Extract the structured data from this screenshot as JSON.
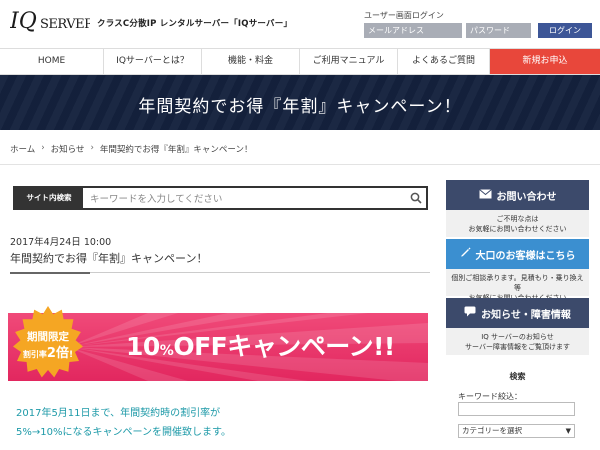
{
  "header": {
    "logo_text": "IQSERVER",
    "tagline": "クラスC分散IP レンタルサーバー「IQサーバー」",
    "login": {
      "label": "ユーザー画面ログイン",
      "email_placeholder": "メールアドレス",
      "password_placeholder": "パスワード",
      "button": "ログイン"
    }
  },
  "nav": {
    "items": [
      {
        "label": "HOME"
      },
      {
        "label": "IQサーバーとは？"
      },
      {
        "label": "機能・料金"
      },
      {
        "label": "ご利用マニュアル"
      },
      {
        "label": "よくあるご質問"
      },
      {
        "label": "新規お申込"
      }
    ]
  },
  "banner": {
    "title": "年間契約でお得『年割』キャンペーン！"
  },
  "breadcrumb": [
    "ホーム",
    "お知らせ",
    "年間契約でお得『年割』キャンペーン！"
  ],
  "search": {
    "label": "サイト内検索",
    "placeholder": "キーワードを入力してください"
  },
  "article": {
    "date": "2017年4月24日 10:00",
    "title": "年間契約でお得『年割』キャンペーン！",
    "promo": {
      "burst_line1": "期間限定",
      "burst_line2_prefix": "割引率",
      "burst_line2_big": "2倍",
      "burst_line2_suffix": "!",
      "headline_num": "10",
      "headline_pct": "%",
      "headline_rest": "OFFキャンペーン!!"
    },
    "body_lines": [
      "2017年5月11日まで、年間契約時の割引率が",
      "5%→10%になるキャンペーンを開催致します。"
    ]
  },
  "sidebar": {
    "contact": {
      "title": "お問い合わせ",
      "sub": [
        "ご不明な点は",
        "お気軽にお問い合わせください"
      ]
    },
    "bulk": {
      "title": "大口のお客様はこちら",
      "sub": [
        "個別ご相談承ります。見積もり・乗り換え等",
        "お気軽にお問い合わせください"
      ]
    },
    "news": {
      "title": "お知らせ・障害情報",
      "sub": [
        "IQ サーバーのお知らせ",
        "サーバー障害情報をご覧頂けます"
      ]
    },
    "search_label": "検索",
    "keyword_label": "キーワード絞込：",
    "category_select": "カテゴリーを選択"
  },
  "colors": {
    "banner_bg": "#14213d",
    "nav_cta": "#e8473b",
    "promo_pink": "#e8326a",
    "burst_orange": "#f5a623",
    "body_teal": "#1e9aa8",
    "login_btn": "#3d5697",
    "sidebar_dark": "#3c4a6b",
    "sidebar_blue": "#3b8fd0"
  }
}
